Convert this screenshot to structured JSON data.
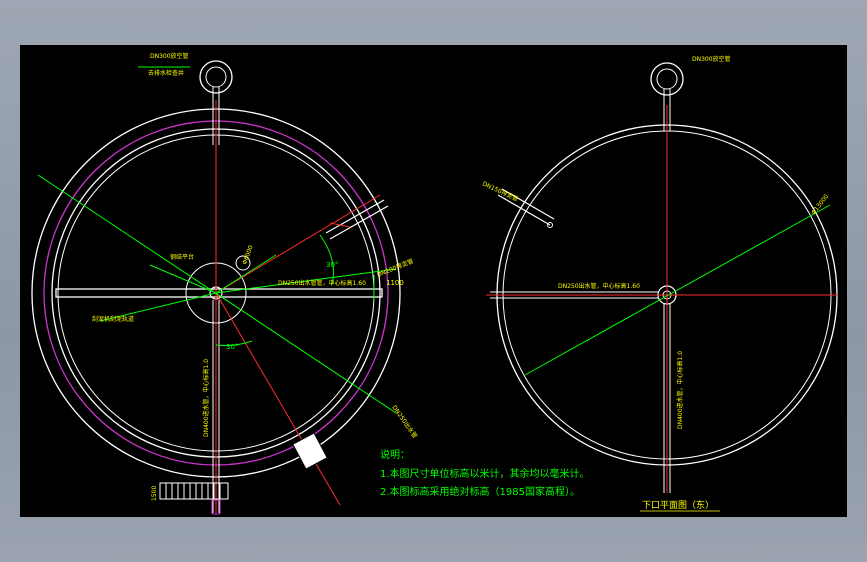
{
  "drawing": {
    "background": "#000000",
    "colors": {
      "structure": "#ffffff",
      "annotation": "#00ff00",
      "axis": "#ff2a2a",
      "pipe_ring": "#cc33cc",
      "label": "#ffff00"
    },
    "left_view": {
      "labels": {
        "top_pipe": "DN300放空管",
        "top_pipe_sub": "去排水检查井",
        "center_platform": "钢结平台",
        "dia_center": "Φ6000",
        "outlet_pipe": "DN250出水管管，中心标高1.60",
        "side_dim": "1100",
        "scum": "刮泥机刮泥轨道",
        "right_pipe": "DN250出水管",
        "upper_pipe": "DN200排泥管",
        "angle_1": "30°",
        "angle_2": "30°",
        "vertical_pipe": "DN400进水管，中心标高1.0",
        "bottom_dim": "1500"
      }
    },
    "right_view": {
      "labels": {
        "top_pipe": "DN300放空管",
        "left_pipe": "DN150排泥管",
        "right_dim": "Φ13000",
        "outlet_pipe": "DN250出水管，中心标高1.60",
        "vertical_pipe": "DN400进水管，中心标高1.0"
      },
      "title": "下口平面图（东）"
    },
    "notes": {
      "heading": "说明：",
      "items": [
        "1.本图尺寸单位标高以米计，其余均以毫米计。",
        "2.本图标高采用绝对标高（1985国家高程）。"
      ]
    }
  }
}
